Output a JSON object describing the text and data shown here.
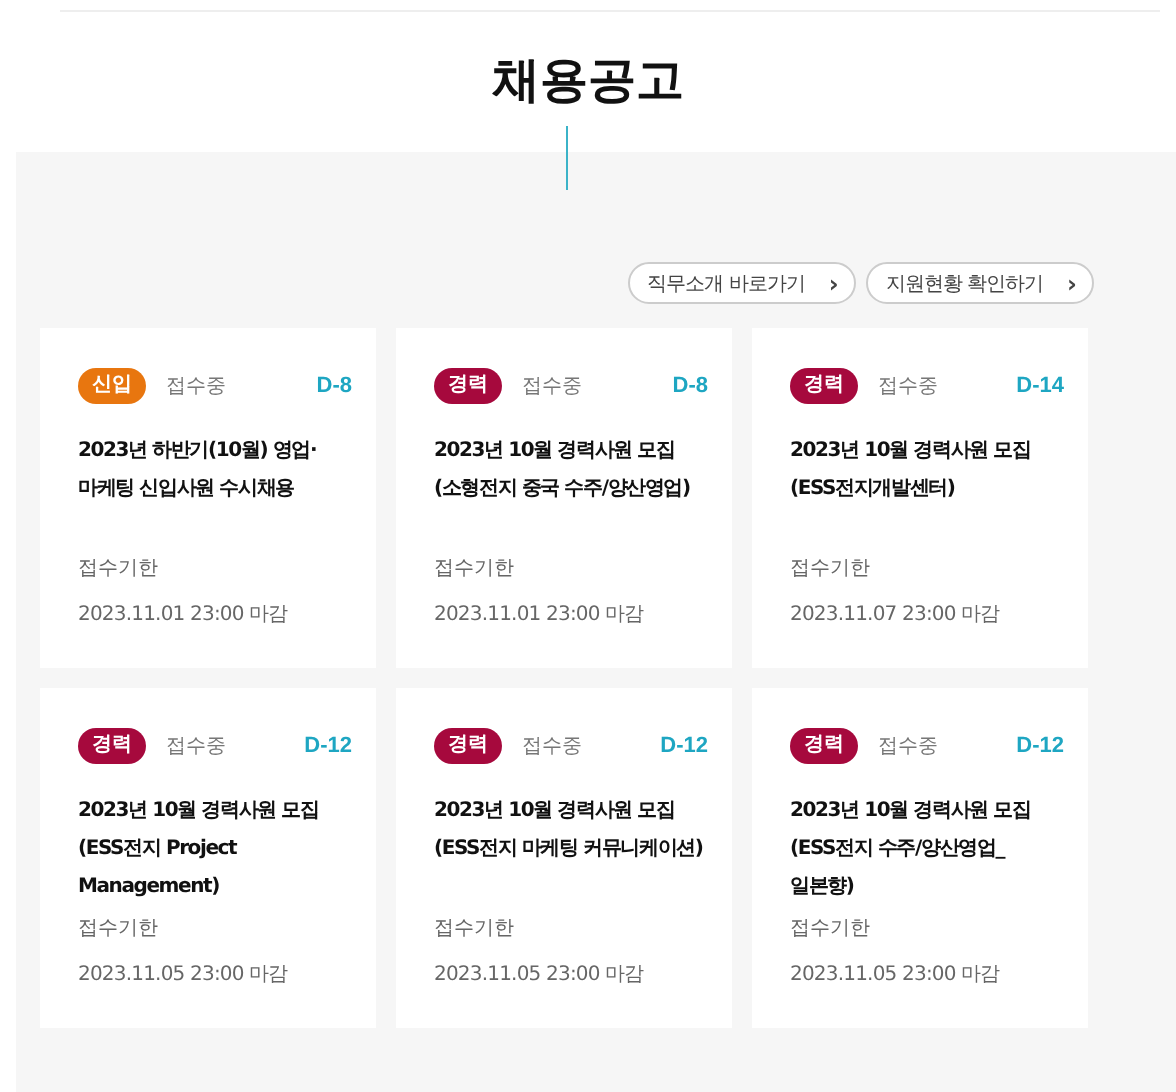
{
  "page_title": "채용공고",
  "links": [
    {
      "label": "직무소개 바로가기",
      "icon": "›"
    },
    {
      "label": "지원현황 확인하기",
      "icon": "›"
    }
  ],
  "jobs": [
    {
      "badge": "신입",
      "kind": "new",
      "status": "접수중",
      "dday": "D-8",
      "title": "2023년 하반기(10월) 영업·마케팅 신입사원 수시채용",
      "deadline_label": "접수기한",
      "deadline": "2023.11.01 23:00 마감"
    },
    {
      "badge": "경력",
      "kind": "experienced",
      "status": "접수중",
      "dday": "D-8",
      "title": "2023년 10월 경력사원 모집 (소형전지 중국 수주/양산영업)",
      "deadline_label": "접수기한",
      "deadline": "2023.11.01 23:00 마감"
    },
    {
      "badge": "경력",
      "kind": "experienced",
      "status": "접수중",
      "dday": "D-14",
      "title": "2023년 10월 경력사원 모집 (ESS전지개발센터)",
      "deadline_label": "접수기한",
      "deadline": "2023.11.07 23:00 마감"
    },
    {
      "badge": "경력",
      "kind": "experienced",
      "status": "접수중",
      "dday": "D-12",
      "title": "2023년 10월 경력사원 모집 (ESS전지 Project Management)",
      "deadline_label": "접수기한",
      "deadline": "2023.11.05 23:00 마감"
    },
    {
      "badge": "경력",
      "kind": "experienced",
      "status": "접수중",
      "dday": "D-12",
      "title": "2023년 10월 경력사원 모집 (ESS전지 마케팅 커뮤니케이션)",
      "deadline_label": "접수기한",
      "deadline": "2023.11.05 23:00 마감"
    },
    {
      "badge": "경력",
      "kind": "experienced",
      "status": "접수중",
      "dday": "D-12",
      "title": "2023년 10월 경력사원 모집 (ESS전지 수주/양산영업_일본향)",
      "deadline_label": "접수기한",
      "deadline": "2023.11.05 23:00 마감"
    }
  ]
}
